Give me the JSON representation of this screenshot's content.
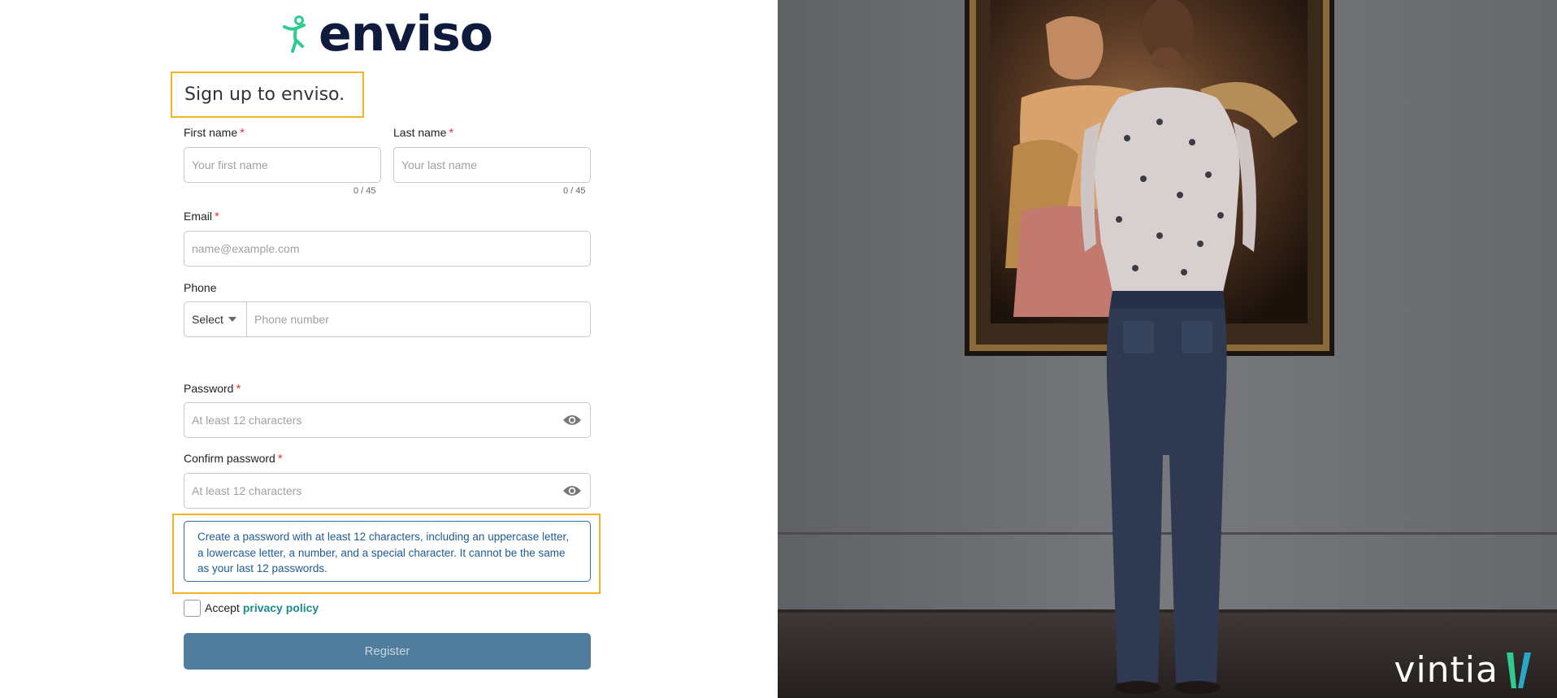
{
  "brand": {
    "logo_text": "enviso",
    "accent": "#2ecc8f",
    "navy": "#0f1b3d"
  },
  "form": {
    "title": "Sign up to enviso.",
    "first_name": {
      "label": "First name",
      "required_mark": "*",
      "placeholder": "Your first name",
      "counter": "0 / 45"
    },
    "last_name": {
      "label": "Last name",
      "required_mark": "*",
      "placeholder": "Your last name",
      "counter": "0 / 45"
    },
    "email": {
      "label": "Email",
      "required_mark": "*",
      "placeholder": "name@example.com"
    },
    "phone": {
      "label": "Phone",
      "country_select": "Select",
      "placeholder": "Phone number"
    },
    "password": {
      "label": "Password",
      "required_mark": "*",
      "placeholder": "At least 12 characters",
      "toggle_icon": "eye-icon"
    },
    "confirm_password": {
      "label": "Confirm password",
      "required_mark": "*",
      "placeholder": "At least 12 characters",
      "toggle_icon": "eye-icon"
    },
    "password_hint": "Create a password with at least 12 characters, including an uppercase letter, a lowercase letter, a number, and a special character. It cannot be the same as your last 12 passwords.",
    "accept_prefix": "Accept",
    "privacy_link": "privacy policy",
    "register_button": "Register"
  },
  "hero": {
    "vintia_logo": "vintia"
  },
  "colors": {
    "highlight_border": "#f5b324",
    "hint_text": "#1f5b94",
    "button_bg": "#4f7d9b",
    "link": "#1b8a8f",
    "required": "#e53935"
  }
}
